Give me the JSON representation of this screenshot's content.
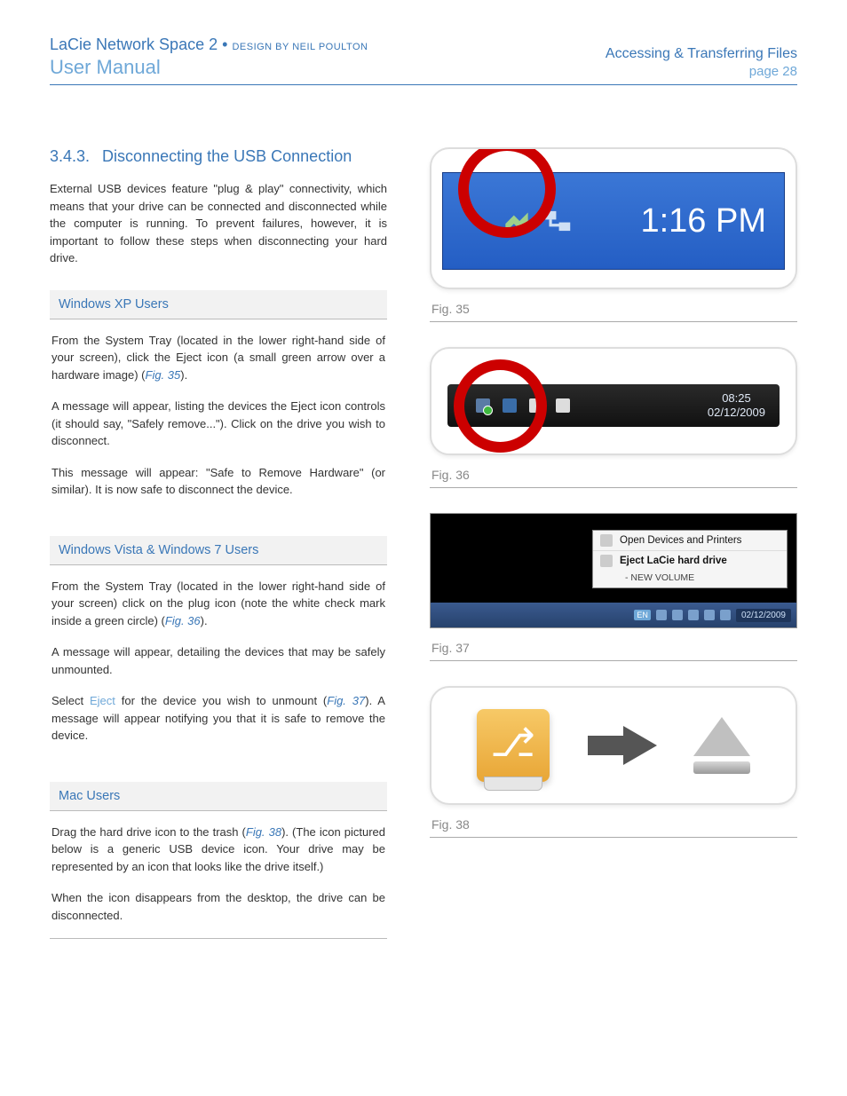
{
  "header": {
    "product": "LaCie Network Space 2",
    "separator": "•",
    "design": "DESIGN BY NEIL POULTON",
    "manual": "User Manual",
    "section": "Accessing & Transferring Files",
    "page": "page 28"
  },
  "heading": {
    "num": "3.4.3.",
    "title": "Disconnecting the USB Connection"
  },
  "intro": "External USB devices feature \"plug & play\" connectivity, which means that your drive can be connected and disconnected while the computer is running.  To prevent failures, however, it is important to follow these steps when disconnecting your hard drive.",
  "xp": {
    "title": "Windows XP Users",
    "p1a": "From the System Tray (located in the lower right-hand side of your screen), click the Eject icon (a small green arrow over a hardware image) (",
    "fig": "Fig. 35",
    "p1b": ").",
    "p2": "A message will appear, listing the devices the Eject icon controls (it should say, \"Safely remove...\"). Click on the drive you wish to disconnect.",
    "p3": "This message will appear: \"Safe to Remove Hardware\" (or similar). It is now safe to disconnect the device."
  },
  "vista": {
    "title": "Windows Vista & Windows 7 Users",
    "p1a": "From the System Tray (located in the lower right-hand side of your screen) click on the plug icon (note the white check mark inside a green circle) (",
    "fig": "Fig. 36",
    "p1b": ").",
    "p2": "A message will appear, detailing the devices that may be safely unmounted.",
    "p3a": "Select ",
    "eject": "Eject",
    "p3b": " for the device you wish to unmount (",
    "fig2": "Fig. 37",
    "p3c": "). A message will appear notifying you that it is safe to remove the device."
  },
  "mac": {
    "title": "Mac Users",
    "p1a": "Drag the hard drive icon to the trash (",
    "fig": "Fig. 38",
    "p1b": "). (The icon pictured below is a generic USB device icon. Your drive may be represented by an icon that looks like the drive itself.)",
    "p2": "When the icon disappears from the desktop, the drive can be disconnected."
  },
  "figs": {
    "f35": {
      "caption": "Fig. 35",
      "time": "1:16 PM"
    },
    "f36": {
      "caption": "Fig. 36",
      "time": "08:25",
      "date": "02/12/2009"
    },
    "f37": {
      "caption": "Fig. 37",
      "menu1": "Open Devices and Printers",
      "menu2": "Eject LaCie hard drive",
      "menu3": "-  NEW VOLUME",
      "lang": "EN",
      "date": "02/12/2009"
    },
    "f38": {
      "caption": "Fig. 38"
    }
  }
}
